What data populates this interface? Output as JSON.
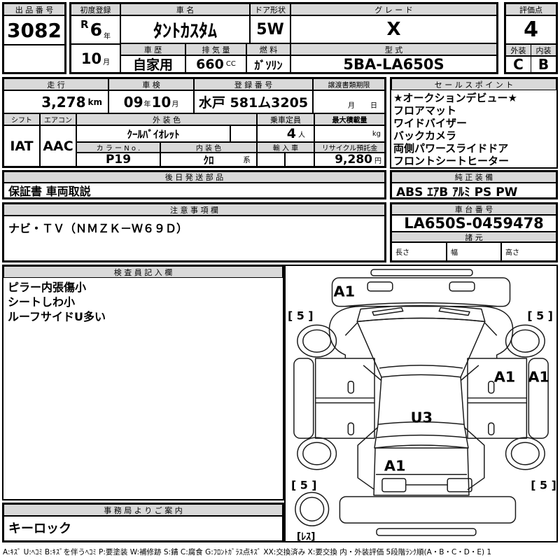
{
  "colors": {
    "header_gray": "#d9d9d9",
    "border": "#000000",
    "background": "#ffffff"
  },
  "top": {
    "auction_no_label": "出 品 番 号",
    "auction_no": "3082",
    "first_reg_label": "初度登録",
    "era": "R",
    "reg_year": "6",
    "year_unit": "年",
    "reg_month": "10",
    "month_unit": "月",
    "car_name_label": "車 名",
    "car_name": "ﾀﾝﾄｶｽﾀﾑ",
    "door_label": "ドア形状",
    "door": "5W",
    "grade_label": "グ レ ー ド",
    "grade": "X",
    "score_label": "評価点",
    "score": "4",
    "history_label": "車 歴",
    "history": "自家用",
    "disp_label": "排 気 量",
    "disp": "660",
    "disp_unit": "CC",
    "fuel_label": "燃 料",
    "fuel": "ｶﾞｿﾘﾝ",
    "model_label": "型 式",
    "model": "5BA-LA650S",
    "ext_label": "外装",
    "ext": "C",
    "int_label": "内装",
    "int": "B"
  },
  "specs": {
    "mileage_label": "走 行",
    "mileage": "3,278",
    "mileage_unit": "km",
    "shaken_label": "車 検",
    "shaken_year": "09",
    "shaken_year_unit": "年",
    "shaken_month": "10",
    "shaken_month_unit": "月",
    "reg_no_label": "登 録 番 号",
    "reg_no": "水戸 581ム3205",
    "transfer_label": "譲渡書類期限",
    "transfer_month": "月",
    "transfer_day": "日",
    "shift_label": "シフト",
    "shift": "IAT",
    "aircon_label": "エアコン",
    "aircon": "AAC",
    "ext_color_label": "外 装 色",
    "ext_color": "ｸｰﾙﾊﾞｲｵﾚｯﾄ",
    "capacity_label": "乗車定員",
    "capacity": "4",
    "capacity_unit": "人",
    "payload_label": "最大積載量",
    "payload_unit": "kg",
    "color_no_label": "カ ラ ー N o .",
    "color_no": "P19",
    "int_color_label": "内 装 色",
    "int_color": "ｸﾛ",
    "int_color_suffix": "系",
    "import_label": "輸 入 車",
    "recycle_label": "リサイクル預託金",
    "recycle": "9,280",
    "recycle_unit": "円"
  },
  "later_parts": {
    "label": "後 日 発 送 部 品",
    "value": "保証書 車両取説"
  },
  "notes": {
    "label": "注 意 事 項 欄",
    "value": "ナビ・ＴＶ（ＮＭＺＫ－Ｗ６９Ｄ）"
  },
  "sales_points": {
    "label": "セ ー ル ス ポ イ ン ト",
    "items": [
      "★オークションデビュー★",
      "フロアマット",
      "ワイドバイザー",
      "バックカメラ",
      "両側パワースライドドア",
      "フロントシートヒーター"
    ]
  },
  "equipment": {
    "label": "純 正 装 備",
    "value": "ABS ｴｱB ｱﾙﾐ PS PW"
  },
  "chassis": {
    "label": "車 台 番 号",
    "value": "LA650S-0459478",
    "spec_label": "諸 元",
    "length_label": "長さ",
    "width_label": "幅",
    "height_label": "高さ"
  },
  "inspector": {
    "label": "検 査 員 記 入 欄",
    "lines": [
      "ピラー内張傷小",
      "シートしわ小",
      "ルーフサイドU多い"
    ]
  },
  "office": {
    "label": "事 務 局 よ り ご 案 内",
    "value": "キーロック"
  },
  "diagram": {
    "labels": {
      "hood": "A1",
      "tire_fl": "[ 5 ]",
      "tire_fr": "[ 5 ]",
      "tire_rl": "[ 5 ]",
      "tire_rr": "[ 5 ]",
      "door_right": "A1",
      "rocker_right": "A1",
      "roof": "U3",
      "rear": "A1",
      "spare": "[ﾚｽ]"
    }
  },
  "footer": {
    "legend": "A:ｷｽﾞ U:ﾍｺﾐ B:ｷｽﾞを伴うﾍｺﾐ P:要塗装 W:補修跡 S:錆 C:腐食 G:ﾌﾛﾝﾄｶﾞﾗｽ点ｷｽﾞ XX:交換済み X:要交換  内・外装評価  5段階ﾗﾝｸ順(A・B・C・D・E) 1"
  }
}
